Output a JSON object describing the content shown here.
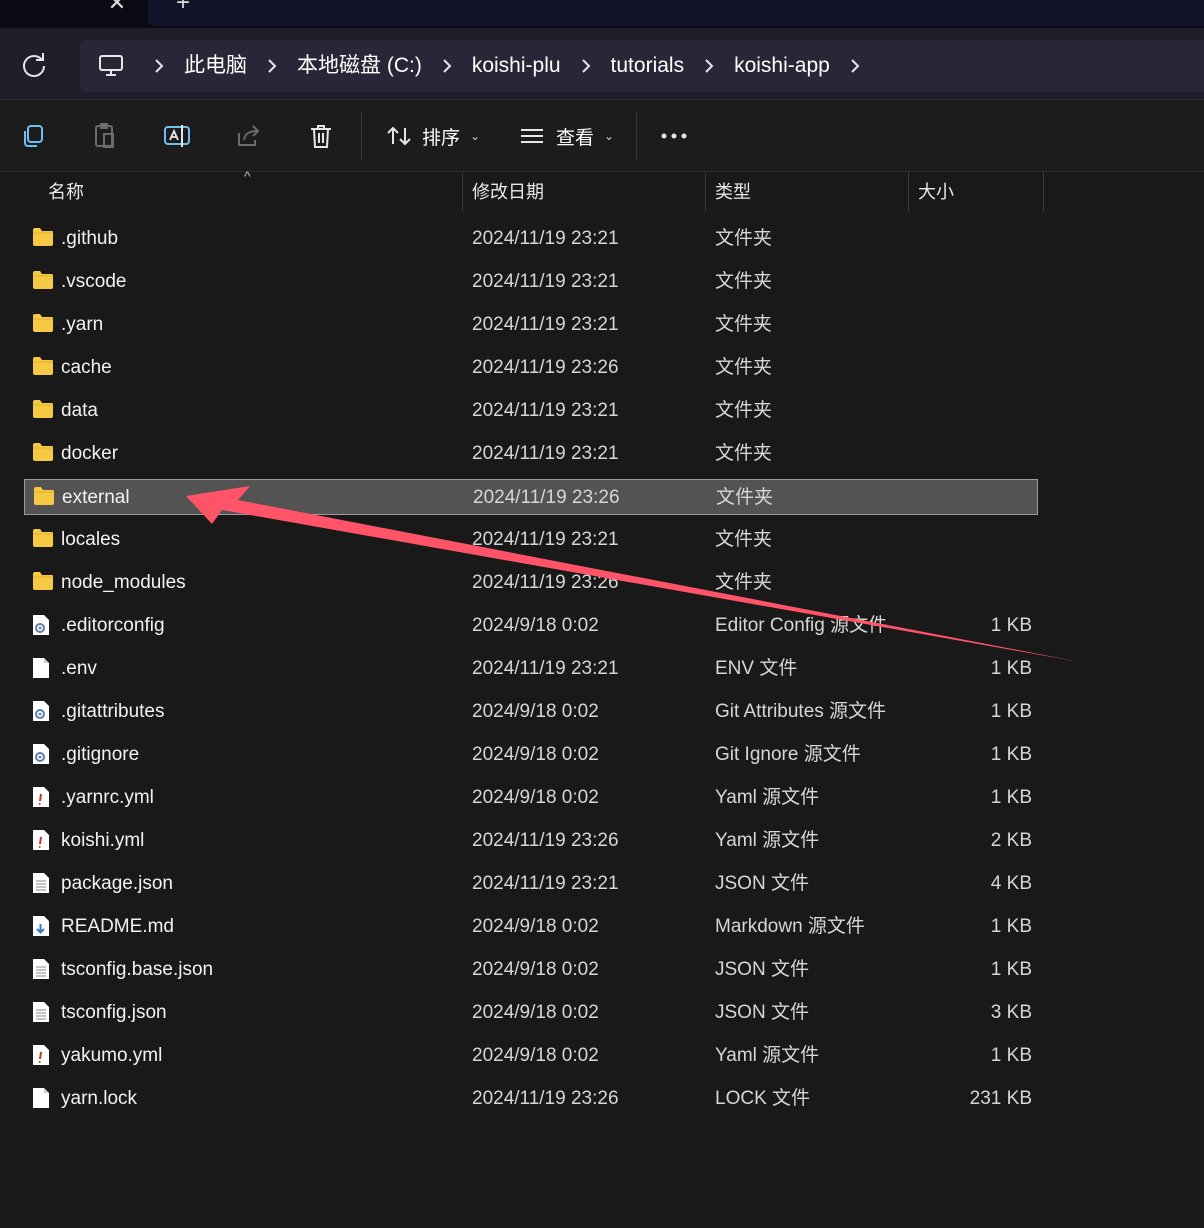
{
  "breadcrumb": [
    "此电脑",
    "本地磁盘 (C:)",
    "koishi-plu",
    "tutorials",
    "koishi-app"
  ],
  "toolbar": {
    "sort_label": "排序",
    "view_label": "查看"
  },
  "columns": {
    "name": "名称",
    "date": "修改日期",
    "type": "类型",
    "size": "大小"
  },
  "files": [
    {
      "name": ".github",
      "date": "2024/11/19 23:21",
      "type": "文件夹",
      "size": "",
      "icon": "folder-icon"
    },
    {
      "name": ".vscode",
      "date": "2024/11/19 23:21",
      "type": "文件夹",
      "size": "",
      "icon": "folder-icon"
    },
    {
      "name": ".yarn",
      "date": "2024/11/19 23:21",
      "type": "文件夹",
      "size": "",
      "icon": "folder-icon"
    },
    {
      "name": "cache",
      "date": "2024/11/19 23:26",
      "type": "文件夹",
      "size": "",
      "icon": "folder-icon"
    },
    {
      "name": "data",
      "date": "2024/11/19 23:21",
      "type": "文件夹",
      "size": "",
      "icon": "folder-icon"
    },
    {
      "name": "docker",
      "date": "2024/11/19 23:21",
      "type": "文件夹",
      "size": "",
      "icon": "folder-icon"
    },
    {
      "name": "external",
      "date": "2024/11/19 23:26",
      "type": "文件夹",
      "size": "",
      "icon": "folder-icon",
      "selected": true
    },
    {
      "name": "locales",
      "date": "2024/11/19 23:21",
      "type": "文件夹",
      "size": "",
      "icon": "folder-icon"
    },
    {
      "name": "node_modules",
      "date": "2024/11/19 23:26",
      "type": "文件夹",
      "size": "",
      "icon": "folder-icon"
    },
    {
      "name": ".editorconfig",
      "date": "2024/9/18 0:02",
      "type": "Editor Config 源文件",
      "size": "1 KB",
      "icon": "config-file-icon"
    },
    {
      "name": ".env",
      "date": "2024/11/19 23:21",
      "type": "ENV 文件",
      "size": "1 KB",
      "icon": "blank-file-icon"
    },
    {
      "name": ".gitattributes",
      "date": "2024/9/18 0:02",
      "type": "Git Attributes 源文件",
      "size": "1 KB",
      "icon": "config-file-icon"
    },
    {
      "name": ".gitignore",
      "date": "2024/9/18 0:02",
      "type": "Git Ignore 源文件",
      "size": "1 KB",
      "icon": "config-file-icon"
    },
    {
      "name": ".yarnrc.yml",
      "date": "2024/9/18 0:02",
      "type": "Yaml 源文件",
      "size": "1 KB",
      "icon": "yaml-file-icon"
    },
    {
      "name": "koishi.yml",
      "date": "2024/11/19 23:26",
      "type": "Yaml 源文件",
      "size": "2 KB",
      "icon": "yaml-file-icon"
    },
    {
      "name": "package.json",
      "date": "2024/11/19 23:21",
      "type": "JSON 文件",
      "size": "4 KB",
      "icon": "text-file-icon"
    },
    {
      "name": "README.md",
      "date": "2024/9/18 0:02",
      "type": "Markdown 源文件",
      "size": "1 KB",
      "icon": "markdown-file-icon"
    },
    {
      "name": "tsconfig.base.json",
      "date": "2024/9/18 0:02",
      "type": "JSON 文件",
      "size": "1 KB",
      "icon": "text-file-icon"
    },
    {
      "name": "tsconfig.json",
      "date": "2024/9/18 0:02",
      "type": "JSON 文件",
      "size": "3 KB",
      "icon": "text-file-icon"
    },
    {
      "name": "yakumo.yml",
      "date": "2024/9/18 0:02",
      "type": "Yaml 源文件",
      "size": "1 KB",
      "icon": "yaml-file-icon"
    },
    {
      "name": "yarn.lock",
      "date": "2024/11/19 23:26",
      "type": "LOCK 文件",
      "size": "231 KB",
      "icon": "blank-file-icon"
    }
  ],
  "colors": {
    "folder": "#f6c945",
    "annotation_arrow": "#ff5468",
    "selection": "#535353"
  }
}
